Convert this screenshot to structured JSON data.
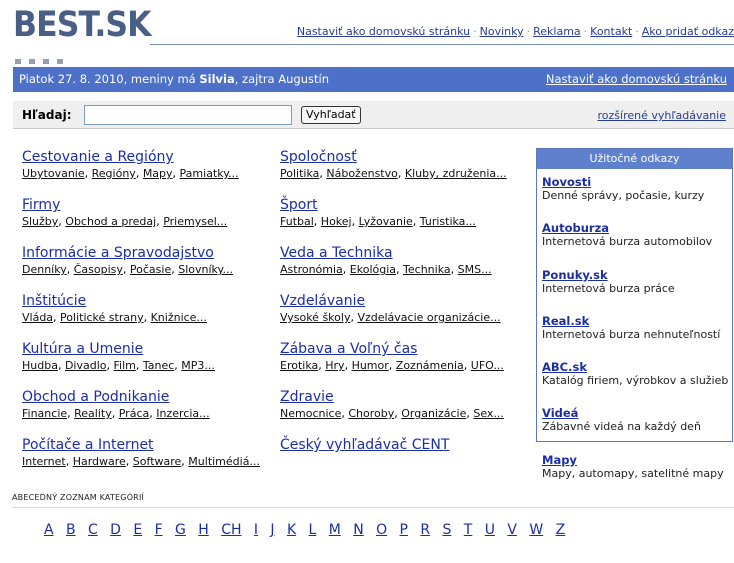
{
  "logo": {
    "text": "BEST.SK"
  },
  "top_links": [
    "Nastaviť ako domovskú stránku",
    "Novinky",
    "Reklama",
    "Kontakt",
    "Ako pridať odkaz"
  ],
  "date_bar": {
    "prefix": "Piatok 27. 8. 2010, meniny má ",
    "name": "Silvia",
    "suffix": ", zajtra Augustín",
    "right_link": "Nastaviť ako domovskú stránku"
  },
  "search": {
    "label": "Hľadaj:",
    "value": "",
    "button": "Vyhľadať",
    "advanced": "rozšírené vyhľadávanie"
  },
  "categories_left": [
    {
      "title": "Cestovanie a Regióny",
      "subs": [
        "Ubytovanie",
        "Regióny",
        "Mapy",
        "Pamiatky..."
      ]
    },
    {
      "title": "Firmy",
      "subs": [
        "Služby",
        "Obchod a predaj",
        "Priemysel..."
      ]
    },
    {
      "title": "Informácie a Spravodajstvo",
      "subs": [
        "Denníky",
        "Časopisy",
        "Počasie",
        "Slovníky..."
      ]
    },
    {
      "title": "Inštitúcie",
      "subs": [
        "Vláda",
        "Politické strany",
        "Knižnice..."
      ]
    },
    {
      "title": "Kultúra a Umenie",
      "subs": [
        "Hudba",
        "Divadlo",
        "Film",
        "Tanec",
        "MP3..."
      ]
    },
    {
      "title": "Obchod a Podnikanie",
      "subs": [
        "Financie",
        "Reality",
        "Práca",
        "Inzercia..."
      ]
    },
    {
      "title": "Počítače a Internet",
      "subs": [
        "Internet",
        "Hardware",
        "Software",
        "Multimédiá..."
      ]
    }
  ],
  "categories_right": [
    {
      "title": "Spoločnosť",
      "subs": [
        "Politika",
        "Náboženstvo",
        "Kluby, združenia..."
      ]
    },
    {
      "title": "Šport",
      "subs": [
        "Futbal",
        "Hokej",
        "Lyžovanie",
        "Turistika..."
      ]
    },
    {
      "title": "Veda a Technika",
      "subs": [
        "Astronómia",
        "Ekológia",
        "Technika",
        "SMS..."
      ]
    },
    {
      "title": "Vzdelávanie",
      "subs": [
        "Vysoké školy",
        "Vzdelávacie organizácie..."
      ]
    },
    {
      "title": "Zábava a Voľný čas",
      "subs": [
        "Erotika",
        "Hry",
        "Humor",
        "Zoznámenia",
        "UFO..."
      ]
    },
    {
      "title": "Zdravie",
      "subs": [
        "Nemocnice",
        "Choroby",
        "Organizácie",
        "Sex..."
      ]
    },
    {
      "title": "Český vyhľadávač CENT",
      "subs": []
    }
  ],
  "useful_links": {
    "header": "Užitočné odkazy",
    "items": [
      {
        "name": "Novosti",
        "desc": "Denné správy, počasie, kurzy"
      },
      {
        "name": "Autoburza",
        "desc": "Internetová burza automobilov"
      },
      {
        "name": "Ponuky.sk",
        "desc": "Internetová burza práce"
      },
      {
        "name": "Real.sk",
        "desc": "Internetová burza nehnuteľností"
      },
      {
        "name": "ABC.sk",
        "desc": "Katalóg firiem, výrobkov a služieb"
      },
      {
        "name": "Videá",
        "desc": "Zábavné videá na každý deň"
      },
      {
        "name": "Mapy",
        "desc": "Mapy, automapy, satelitné mapy"
      }
    ]
  },
  "alphabet": {
    "label": "ABECEDNÝ ZOZNAM KATEGÓRIÍ",
    "letters": [
      "A",
      "B",
      "C",
      "D",
      "E",
      "F",
      "G",
      "H",
      "CH",
      "I",
      "J",
      "K",
      "L",
      "M",
      "N",
      "O",
      "P",
      "R",
      "S",
      "T",
      "U",
      "V",
      "W",
      "Z"
    ]
  }
}
